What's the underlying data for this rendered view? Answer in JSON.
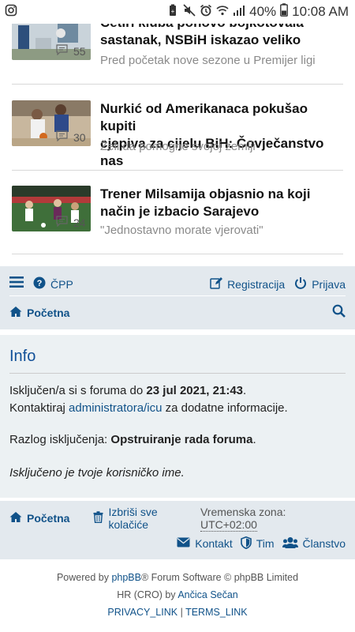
{
  "statusbar": {
    "battery": "40%",
    "time": "10:08 AM"
  },
  "news": [
    {
      "title_lines": [
        "Četiri kluba ponovo bojkotovala",
        "sastanak, NSBiH iskazao veliko"
      ],
      "subtitle": "Pred početak nove sezone u Premijer ligi",
      "comments": "55"
    },
    {
      "title_lines": [
        "Nurkić od Amerikanaca pokušao kupiti",
        "cjepiva za cijelu BiH: Čovječanstvo nas"
      ],
      "subtitle": "Želi da pomogne svojoj zemlji",
      "comments": "30"
    },
    {
      "title_lines": [
        "Trener Milsamija objasnio na koji",
        "način je izbacio Sarajevo"
      ],
      "subtitle": "\"Jednostavno morate vjerovati\"",
      "comments": "24"
    }
  ],
  "navbar": {
    "faq": "ČPP",
    "register": "Registracija",
    "login": "Prijava",
    "home": "Početna"
  },
  "info": {
    "title": "Info",
    "line1_prefix": "Isključen/a si s foruma do ",
    "line1_date": "23 jul 2021, 21:43",
    "line1_suffix": ".",
    "line2_prefix": "Kontaktiraj ",
    "line2_link": "administratora/icu",
    "line2_suffix": " za dodatne informacije.",
    "reason_prefix": "Razlog isključenja: ",
    "reason": "Opstruiranje rada foruma",
    "reason_suffix": ".",
    "note": "Isključeno je tvoje korisničko ime."
  },
  "footer": {
    "home": "Početna",
    "delete_cookies": "Izbriši sve kolačiće",
    "tz_label": "Vremenska zona: ",
    "tz_value": "UTC+02:00",
    "contact": "Kontakt",
    "team": "Tim",
    "members": "Članstvo"
  },
  "copyright": {
    "powered_by": "Powered by ",
    "phpbb": "phpBB",
    "software": "® Forum Software © phpBB Limited",
    "translation": "HR (CRO) by ",
    "translator": "Ančica Sečan",
    "privacy": "PRIVACY_LINK",
    "sep": " | ",
    "terms": "TERMS_LINK"
  },
  "colors": {
    "link": "#105289",
    "panel": "#e3e9ee",
    "info_bg": "#ecf1f3"
  }
}
